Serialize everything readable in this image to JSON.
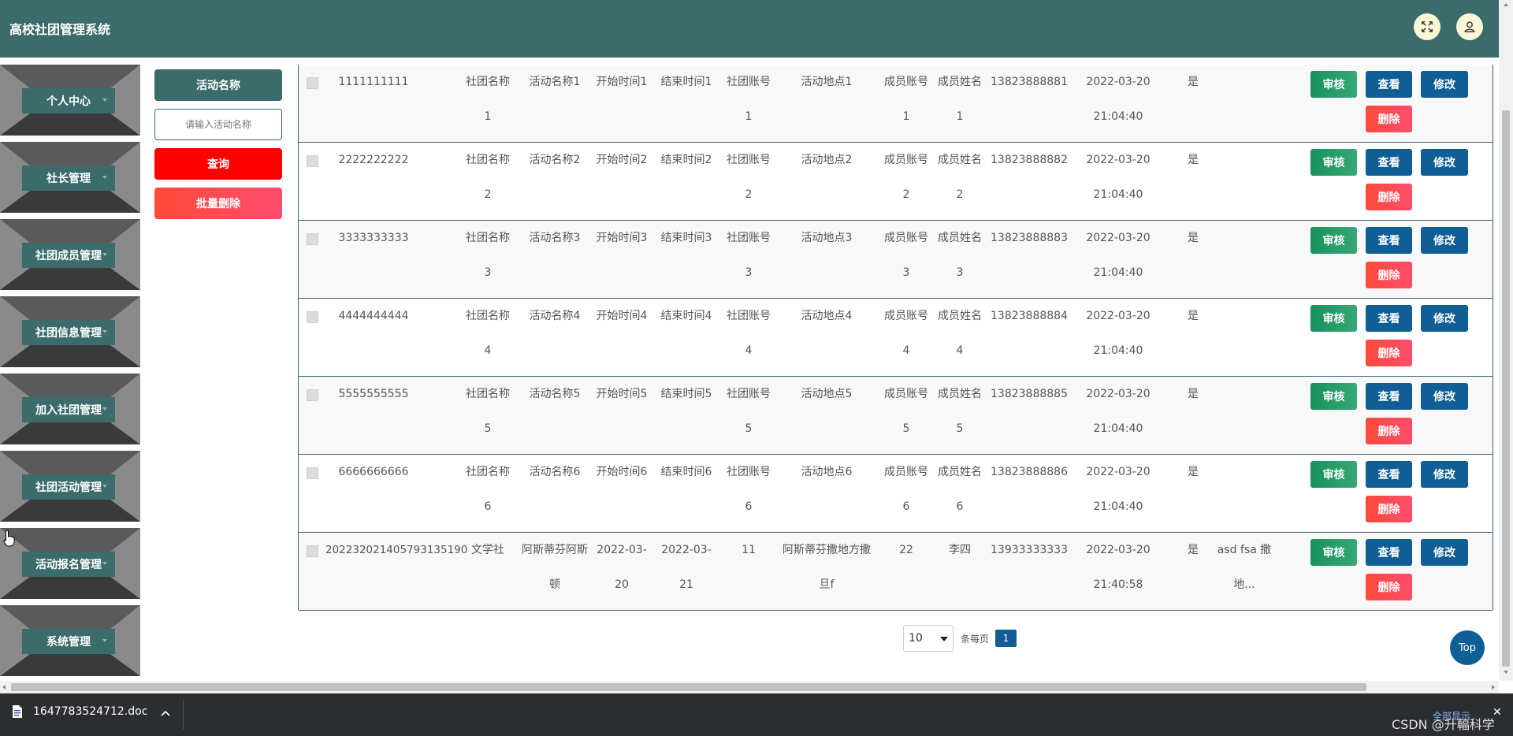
{
  "header": {
    "title": "高校社团管理系统",
    "fullscreen_icon": "expand-icon",
    "user_icon": "user-icon"
  },
  "sidebar": {
    "items": [
      {
        "label": "个人中心"
      },
      {
        "label": "社长管理"
      },
      {
        "label": "社团成员管理"
      },
      {
        "label": "社团信息管理"
      },
      {
        "label": "加入社团管理"
      },
      {
        "label": "社团活动管理"
      },
      {
        "label": "活动报名管理"
      },
      {
        "label": "系统管理"
      }
    ]
  },
  "search": {
    "field_label": "活动名称",
    "placeholder": "请输入活动名称",
    "query_button": "查询",
    "batch_delete_button": "批量删除"
  },
  "table": {
    "actions": {
      "audit": "审核",
      "view": "查看",
      "edit": "修改",
      "delete": "删除"
    },
    "rows": [
      {
        "id": "1111111111",
        "club_a": "社团名称",
        "club_b": "1",
        "act_a": "活动名称1",
        "act_b": "",
        "start_a": "开始时间1",
        "start_b": "",
        "end_a": "结束时间1",
        "end_b": "",
        "acct_a": "社团账号",
        "acct_b": "1",
        "place_a": "活动地点1",
        "place_b": "",
        "macct_a": "成员账号",
        "macct_b": "1",
        "mname_a": "成员姓名",
        "mname_b": "1",
        "phone": "13823888881",
        "date": "2022-03-20",
        "time": "21:04:40",
        "yes": "是",
        "note_a": "",
        "note_b": ""
      },
      {
        "id": "2222222222",
        "club_a": "社团名称",
        "club_b": "2",
        "act_a": "活动名称2",
        "act_b": "",
        "start_a": "开始时间2",
        "start_b": "",
        "end_a": "结束时间2",
        "end_b": "",
        "acct_a": "社团账号",
        "acct_b": "2",
        "place_a": "活动地点2",
        "place_b": "",
        "macct_a": "成员账号",
        "macct_b": "2",
        "mname_a": "成员姓名",
        "mname_b": "2",
        "phone": "13823888882",
        "date": "2022-03-20",
        "time": "21:04:40",
        "yes": "是",
        "note_a": "",
        "note_b": ""
      },
      {
        "id": "3333333333",
        "club_a": "社团名称",
        "club_b": "3",
        "act_a": "活动名称3",
        "act_b": "",
        "start_a": "开始时间3",
        "start_b": "",
        "end_a": "结束时间3",
        "end_b": "",
        "acct_a": "社团账号",
        "acct_b": "3",
        "place_a": "活动地点3",
        "place_b": "",
        "macct_a": "成员账号",
        "macct_b": "3",
        "mname_a": "成员姓名",
        "mname_b": "3",
        "phone": "13823888883",
        "date": "2022-03-20",
        "time": "21:04:40",
        "yes": "是",
        "note_a": "",
        "note_b": ""
      },
      {
        "id": "4444444444",
        "club_a": "社团名称",
        "club_b": "4",
        "act_a": "活动名称4",
        "act_b": "",
        "start_a": "开始时间4",
        "start_b": "",
        "end_a": "结束时间4",
        "end_b": "",
        "acct_a": "社团账号",
        "acct_b": "4",
        "place_a": "活动地点4",
        "place_b": "",
        "macct_a": "成员账号",
        "macct_b": "4",
        "mname_a": "成员姓名",
        "mname_b": "4",
        "phone": "13823888884",
        "date": "2022-03-20",
        "time": "21:04:40",
        "yes": "是",
        "note_a": "",
        "note_b": ""
      },
      {
        "id": "5555555555",
        "club_a": "社团名称",
        "club_b": "5",
        "act_a": "活动名称5",
        "act_b": "",
        "start_a": "开始时间5",
        "start_b": "",
        "end_a": "结束时间5",
        "end_b": "",
        "acct_a": "社团账号",
        "acct_b": "5",
        "place_a": "活动地点5",
        "place_b": "",
        "macct_a": "成员账号",
        "macct_b": "5",
        "mname_a": "成员姓名",
        "mname_b": "5",
        "phone": "13823888885",
        "date": "2022-03-20",
        "time": "21:04:40",
        "yes": "是",
        "note_a": "",
        "note_b": ""
      },
      {
        "id": "6666666666",
        "club_a": "社团名称",
        "club_b": "6",
        "act_a": "活动名称6",
        "act_b": "",
        "start_a": "开始时间6",
        "start_b": "",
        "end_a": "结束时间6",
        "end_b": "",
        "acct_a": "社团账号",
        "acct_b": "6",
        "place_a": "活动地点6",
        "place_b": "",
        "macct_a": "成员账号",
        "macct_b": "6",
        "mname_a": "成员姓名",
        "mname_b": "6",
        "phone": "13823888886",
        "date": "2022-03-20",
        "time": "21:04:40",
        "yes": "是",
        "note_a": "",
        "note_b": ""
      },
      {
        "id": "20223202140579313519​0",
        "club_a": "文学社",
        "club_b": "",
        "act_a": "阿斯蒂芬阿斯",
        "act_b": "顿",
        "start_a": "2022-03-",
        "start_b": "20",
        "end_a": "2022-03-",
        "end_b": "21",
        "acct_a": "11",
        "acct_b": "",
        "place_a": "阿斯蒂芬撒地方撒",
        "place_b": "旦f",
        "macct_a": "22",
        "macct_b": "",
        "mname_a": "李四",
        "mname_b": "",
        "phone": "13933333333",
        "date": "2022-03-20",
        "time": "21:40:58",
        "yes": "是",
        "note_a": "asd fsa 撒",
        "note_b": "地..."
      }
    ]
  },
  "pagination": {
    "page_size": "10",
    "per_page_label": "条每页",
    "current_page": "1"
  },
  "back_to_top": "Top",
  "download_bar": {
    "file_name": "1647783524712.doc",
    "show_all": "全部显示",
    "close": "✕"
  },
  "watermark": "CSDN @升輻科学"
}
